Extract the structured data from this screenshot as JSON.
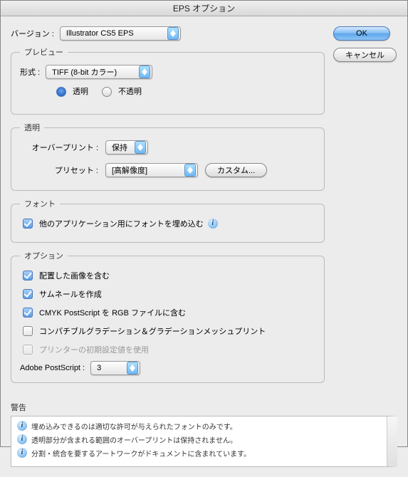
{
  "window": {
    "title": "EPS オプション"
  },
  "buttons": {
    "ok": "OK",
    "cancel": "キャンセル",
    "custom": "カスタム..."
  },
  "version": {
    "label": "バージョン :",
    "value": "Illustrator CS5 EPS"
  },
  "preview": {
    "legend": "プレビュー",
    "format_label": "形式 :",
    "format_value": "TIFF (8-bit カラー)",
    "transparent": "透明",
    "opaque": "不透明"
  },
  "transparency": {
    "legend": "透明",
    "overprint_label": "オーバープリント :",
    "overprint_value": "保持",
    "preset_label": "プリセット :",
    "preset_value": "[高解像度]"
  },
  "fonts": {
    "legend": "フォント",
    "embed_label": "他のアプリケーション用にフォントを埋め込む"
  },
  "options": {
    "legend": "オプション",
    "include_images": "配置した画像を含む",
    "thumbnails": "サムネールを作成",
    "cmyk_rgb": "CMYK PostScript を RGB ファイルに含む",
    "compat_grad": "コンパチブルグラデーション＆グラデーションメッシュプリント",
    "printer_defaults": "プリンターの初期設定値を使用",
    "ps_label": "Adobe PostScript :",
    "ps_value": "3"
  },
  "warnings": {
    "label": "警告",
    "items": [
      "埋め込みできるのは適切な許可が与えられたフォントのみです。",
      "透明部分が含まれる範囲のオーバープリントは保持されません。",
      "分割・統合を要するアートワークがドキュメントに含まれています。"
    ]
  }
}
